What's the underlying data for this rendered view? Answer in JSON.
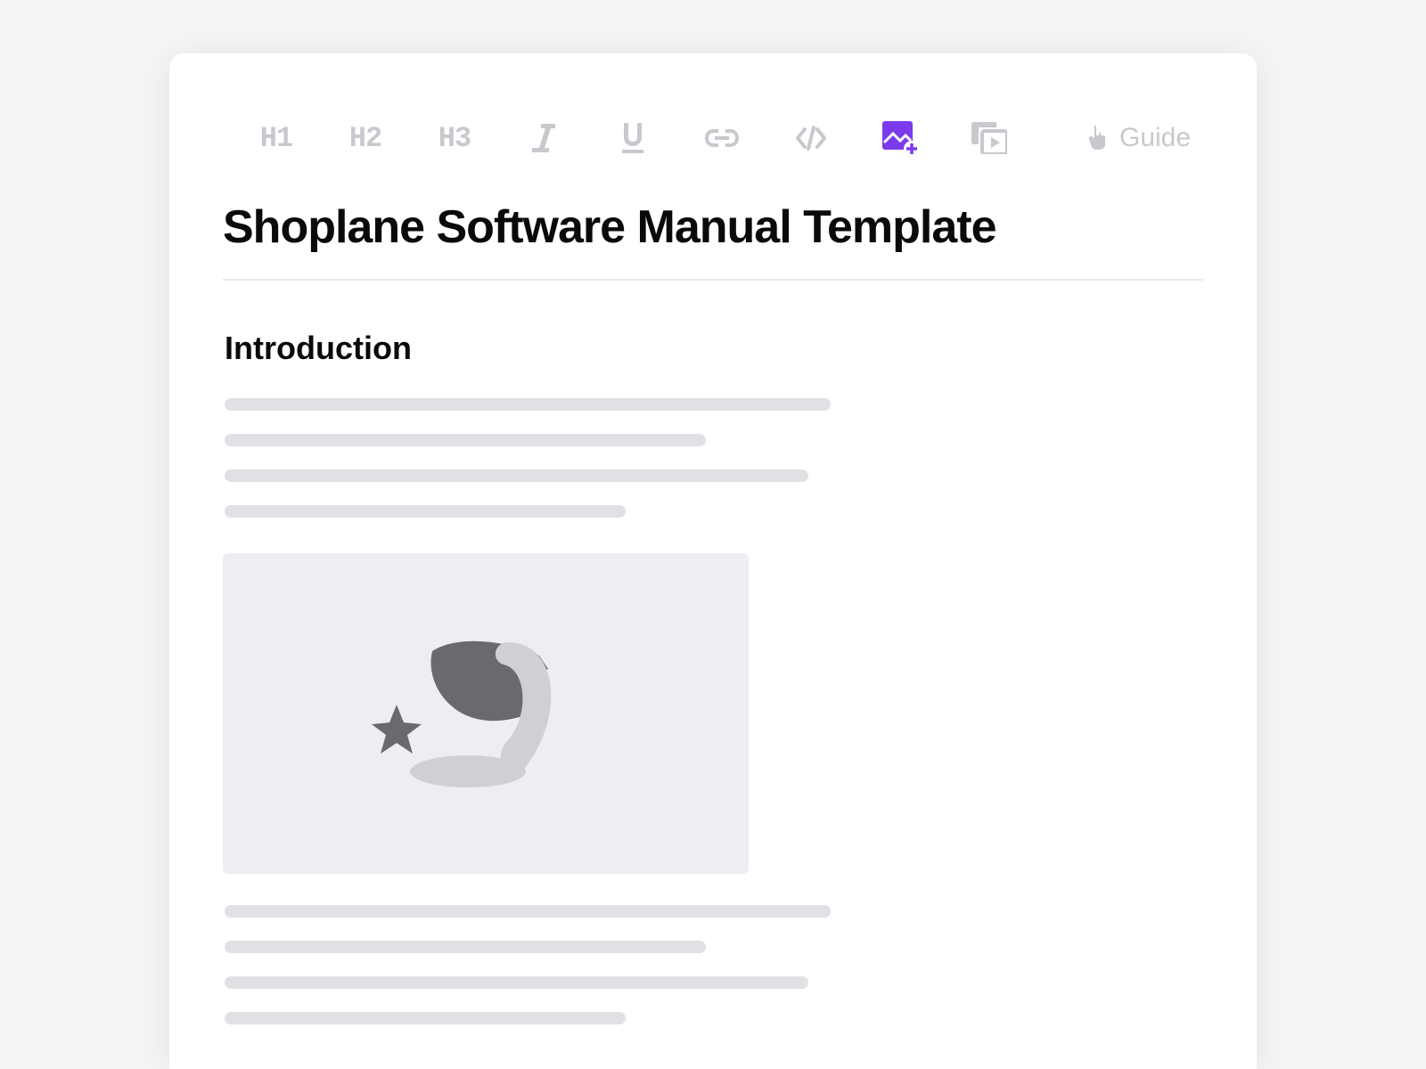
{
  "toolbar": {
    "h1_label": "H1",
    "h2_label": "H2",
    "h3_label": "H3",
    "guide_label": "Guide",
    "active_item": "image"
  },
  "document": {
    "title": "Shoplane Software Manual Template",
    "section_heading": "Introduction"
  },
  "colors": {
    "accent": "#7c3aed",
    "muted": "#c8c8ce",
    "skeleton": "#e1e1e5",
    "placeholder_bg": "#eeeef2"
  }
}
